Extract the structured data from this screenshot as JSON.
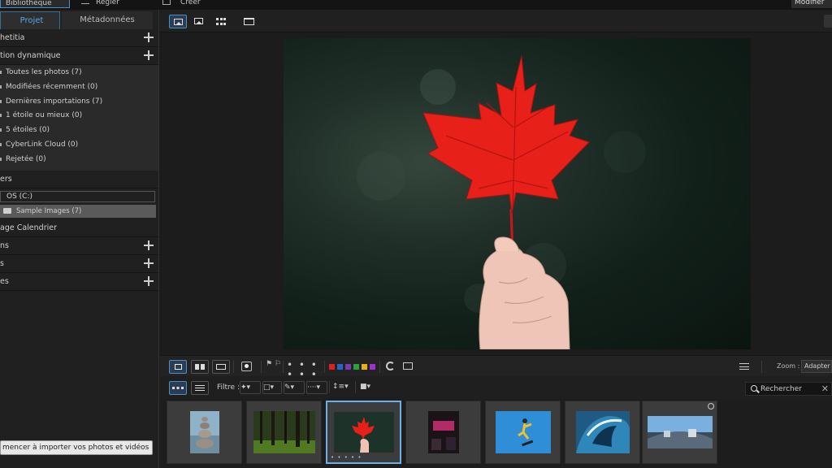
{
  "top_tabs": {
    "library": "Bibliothèque",
    "adjust": "Régler",
    "create": "Créer",
    "modify": "Modifier la"
  },
  "left_panel": {
    "tabs": [
      "Projet",
      "Métadonnées"
    ],
    "sections": {
      "quick": "hetitia",
      "dynamic": "tion dynamique",
      "folders": "ers",
      "calendar": "age Calendrier",
      "s1": "ns",
      "s2": "s",
      "s3": "es"
    },
    "dynamic_items": [
      "Toutes les photos (7)",
      "Modifiées récemment (0)",
      "Dernières importations (7)",
      "1 étoile ou mieux (0)",
      "5 étoiles (0)",
      "CyberLink Cloud (0)",
      "Rejetée (0)"
    ],
    "drive": "OS (C:)",
    "subfolder": "Sample Images (7)",
    "import_button": "mencer à importer vos photos et vidéos ici"
  },
  "toolbar": {
    "zoom_label": "Zoom :",
    "zoom_value": "Adapter",
    "stars": "• • • • • •",
    "colors": [
      "#e0201e",
      "#2a62c8",
      "#7a39b0",
      "#28a03c",
      "#e8b010",
      "#9e2fd0"
    ]
  },
  "filter": {
    "label": "Filtre :",
    "search_placeholder": "Rechercher"
  },
  "filmstrip": {
    "selected_index": 2,
    "items": [
      "rock-balance",
      "forest",
      "maple-leaf",
      "neon-sign",
      "skateboarder",
      "wave",
      "panorama"
    ]
  },
  "colors": {
    "accent": "#4a90c8",
    "leaf_red": "#e8201a"
  }
}
